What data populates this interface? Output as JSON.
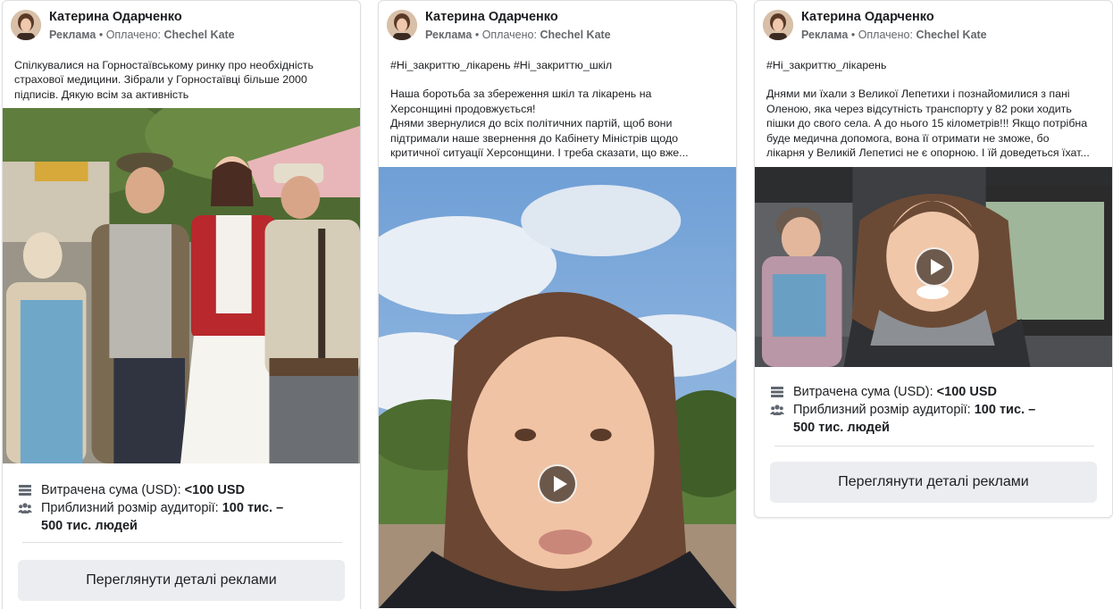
{
  "cards": [
    {
      "page_name": "Катерина Одарченко",
      "sponsored": "Реклама",
      "separator": "•",
      "paid_by_label": "Оплачено:",
      "paid_by_name": "Chechel Kate",
      "text_lines": [
        "Спілкувалися на Горностаївському ринку про необхідність",
        "страхової медицини. Зібрали у Горностаївці більше 2000",
        "підписів. Дякую всім за активність"
      ],
      "media_type": "photo",
      "spent_label": "Витрачена сума (USD):",
      "spent_value": "<100 USD",
      "audience_label": "Приблизний розмір аудиторії:",
      "audience_value_1": "100 тис. –",
      "audience_value_2": "500 тис. людей",
      "details_button": "Переглянути деталі реклами"
    },
    {
      "page_name": "Катерина Одарченко",
      "sponsored": "Реклама",
      "separator": "•",
      "paid_by_label": "Оплачено:",
      "paid_by_name": "Chechel Kate",
      "hashtags": "#Ні_закриттю_лікарень #Ні_закриттю_шкіл",
      "text_lines": [
        "Наша боротьба за збереження шкіл та лікарень на",
        "Херсонщині продовжується!",
        "Днями звернулися до всіх політичних партій, щоб вони",
        "підтримали наше звернення до Кабінету Міністрів щодо",
        "критичної ситуації Херсонщини. І треба сказати, що вже..."
      ],
      "media_type": "video"
    },
    {
      "page_name": "Катерина Одарченко",
      "sponsored": "Реклама",
      "separator": "•",
      "paid_by_label": "Оплачено:",
      "paid_by_name": "Chechel Kate",
      "hashtags": "#Ні_закриттю_лікарень",
      "text_lines": [
        "Днями ми їхали з Великої Лепетихи і познайомилися з пані",
        "Оленою, яка через відсутність транспорту у 82 роки ходить",
        "пішки до свого села. А до нього 15 кілометрів!!! Якщо потрібна",
        "буде медична допомога, вона її отримати не зможе, бо",
        "лікарня у Великій Лепетисі не є опорною. І їй доведеться їхат..."
      ],
      "media_type": "video",
      "spent_label": "Витрачена сума (USD):",
      "spent_value": "<100 USD",
      "audience_label": "Приблизний розмір аудиторії:",
      "audience_value_1": "100 тис. –",
      "audience_value_2": "500 тис. людей",
      "details_button": "Переглянути деталі реклами"
    }
  ],
  "icons": {
    "spent": "money-stack-icon",
    "audience": "people-icon",
    "play": "play-icon"
  },
  "colors": {
    "button_bg": "#ebedf0",
    "secondary_text": "#65676b",
    "border": "#dddfe2"
  }
}
